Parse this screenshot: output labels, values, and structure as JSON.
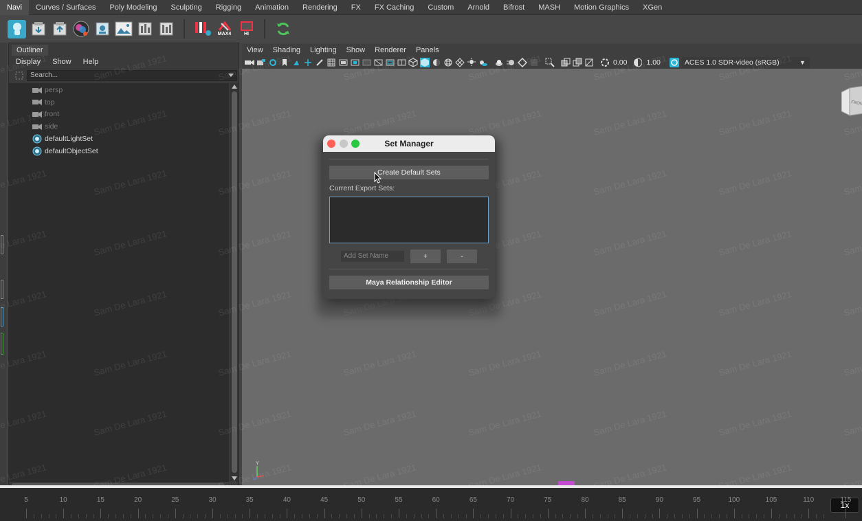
{
  "shelf": {
    "tabs": [
      "Navi",
      "Curves / Surfaces",
      "Poly Modeling",
      "Sculpting",
      "Rigging",
      "Animation",
      "Rendering",
      "FX",
      "FX Caching",
      "Custom",
      "Arnold",
      "Bifrost",
      "MASH",
      "Motion Graphics",
      "XGen"
    ],
    "active_tab": "Navi",
    "icons": [
      "head-icon",
      "import-icon",
      "export-icon",
      "sphere-color-icon",
      "reference-icon",
      "image-icon",
      "bars-icon",
      "bars2-icon",
      "max-import-icon",
      "max4-icon",
      "hi-icon",
      "refresh-icon"
    ],
    "max4_label": "MAX4",
    "hi_label": "HI"
  },
  "outliner": {
    "tab_label": "Outliner",
    "menu": [
      "Display",
      "Show",
      "Help"
    ],
    "search_placeholder": "Search...",
    "items": [
      {
        "label": "persp",
        "type": "camera",
        "dim": true
      },
      {
        "label": "top",
        "type": "camera",
        "dim": true
      },
      {
        "label": "front",
        "type": "camera",
        "dim": true
      },
      {
        "label": "side",
        "type": "camera",
        "dim": true
      },
      {
        "label": "defaultLightSet",
        "type": "set",
        "dim": false
      },
      {
        "label": "defaultObjectSet",
        "type": "set",
        "dim": false
      }
    ]
  },
  "viewport": {
    "menu": [
      "View",
      "Shading",
      "Lighting",
      "Show",
      "Renderer",
      "Panels"
    ],
    "exposure": "0.00",
    "gamma": "1.00",
    "colorspace": "ACES 1.0 SDR-video (sRGB)",
    "axis_y": "Y"
  },
  "dialog": {
    "title": "Set Manager",
    "create_default_label": "Create Default Sets",
    "export_sets_label": "Current Export Sets:",
    "add_set_placeholder": "Add Set Name",
    "plus_label": "+",
    "minus_label": "-",
    "relationship_editor_label": "Maya Relationship Editor"
  },
  "watermark": "Sam De Lara 1921",
  "timeline": {
    "ticks": [
      "5",
      "10",
      "15",
      "20",
      "25",
      "30",
      "35",
      "40",
      "45",
      "50",
      "55",
      "60",
      "65",
      "70",
      "75",
      "80",
      "85",
      "90",
      "95",
      "100",
      "105",
      "110",
      "115"
    ],
    "speed_label": "1x"
  },
  "colors": {
    "accent_cyan": "#29b6d6",
    "export_list_border": "#6fa0c8",
    "current_frame": "#c24bd1",
    "traffic_close": "#fe5f57",
    "traffic_min": "#bdbdbd",
    "traffic_max": "#28c840"
  }
}
